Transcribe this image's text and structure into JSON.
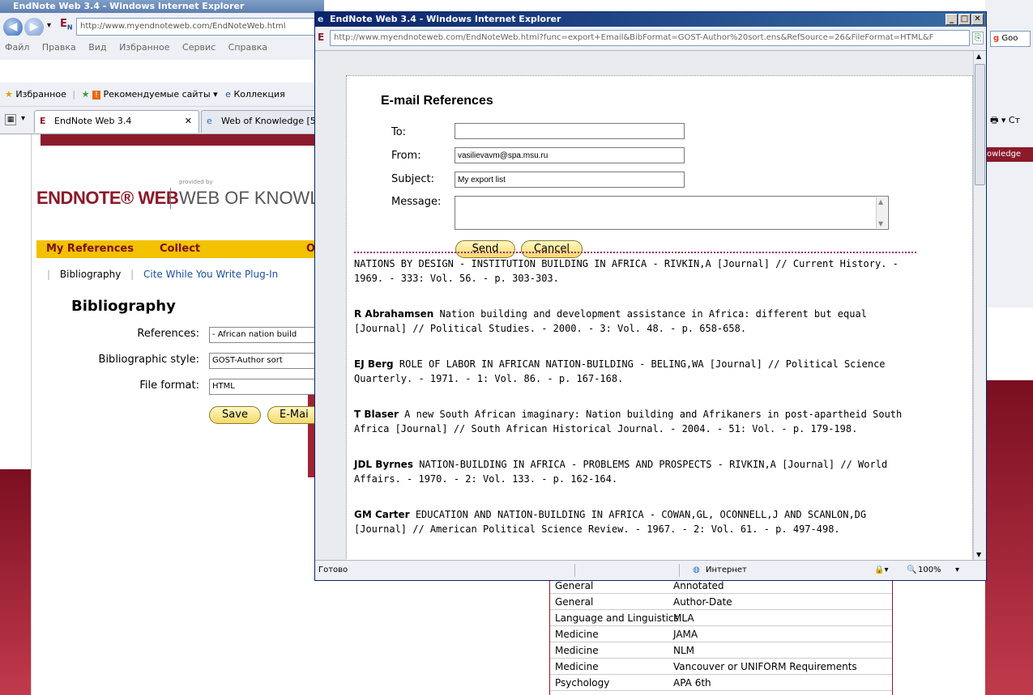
{
  "bg_window": {
    "title": "EndNote Web 3.4 - Windows Internet Explorer",
    "url": "http://www.myendnoteweb.com/EndNoteWeb.html",
    "menu": [
      "Файл",
      "Правка",
      "Вид",
      "Избранное",
      "Сервис",
      "Справка"
    ],
    "favorites_label": "Избранное",
    "fav_links": [
      "Рекомендуемые сайты ▾",
      "Коллекция"
    ],
    "tabs": [
      "EndNote Web 3.4",
      "Web of Knowledge [5"
    ],
    "right_band_text": "owledge",
    "right_addr_text": "Goo",
    "right_toolbar_text": "Ст"
  },
  "endnote": {
    "logo": "ENDNOTE® WEB",
    "provided_by": "provided by",
    "wok": "WEB OF KNOWLEDG",
    "tabs": [
      "My References",
      "Collect",
      "Or"
    ],
    "subnav": [
      "Bibliography",
      "Cite While You Write Plug-In"
    ],
    "page_title": "Bibliography",
    "fields": [
      {
        "label": "References:",
        "value": "- African nation build"
      },
      {
        "label": "Bibliographic style:",
        "value": "GOST-Author sort"
      },
      {
        "label": "File format:",
        "value": "HTML"
      }
    ],
    "save_label": "Save",
    "email_label": "E-Mai"
  },
  "popup": {
    "title": "EndNote Web 3.4 - Windows Internet Explorer",
    "url": "http://www.myendnoteweb.com/EndNoteWeb.html?func=export+Email&BibFormat=GOST-Author%20sort.ens&RefSource=26&FileFormat=HTML&F",
    "status_ready": "Готово",
    "status_zone": "Интернет",
    "zoom": "100%",
    "email": {
      "heading": "E-mail References",
      "to_label": "To:",
      "to_value": "",
      "from_label": "From:",
      "from_value": "vasilievavm@spa.msu.ru",
      "subject_label": "Subject:",
      "subject_value": "My export list",
      "message_label": "Message:",
      "send": "Send",
      "cancel": "Cancel"
    },
    "references": [
      {
        "author": "",
        "text": "NATIONS BY DESIGN - INSTITUTION BUILDING IN AFRICA - RIVKIN,A [Journal] // Current History. - 1969. - 333: Vol. 56. - p. 303-303."
      },
      {
        "author": "R Abrahamsen",
        "text": "Nation building and development assistance in Africa: different but equal [Journal] // Political Studies. - 2000. - 3: Vol. 48. - p. 658-658."
      },
      {
        "author": "EJ Berg",
        "text": "ROLE OF LABOR IN AFRICAN NATION-BUILDING - BELING,WA [Journal] // Political Science Quarterly. - 1971. - 1: Vol. 86. - p. 167-168."
      },
      {
        "author": "T Blaser",
        "text": "A new South African imaginary: Nation building and Afrikaners in post-apartheid South Africa [Journal] // South African Historical Journal. - 2004. - 51: Vol. - p. 179-198."
      },
      {
        "author": "JDL Byrnes",
        "text": "NATION-BUILDING IN AFRICA - PROBLEMS AND PROSPECTS - RIVKIN,A [Journal] // World Affairs. - 1970. - 2: Vol. 133. - p. 162-164."
      },
      {
        "author": "GM Carter",
        "text": "EDUCATION AND NATION-BUILDING IN AFRICA - COWAN,GL, OCONNELL,J AND SCANLON,DG [Journal] // American Political Science Review. - 1967. - 2: Vol. 61. - p. 497-498."
      }
    ]
  },
  "styles_table": [
    {
      "category": "General",
      "style": "Annotated"
    },
    {
      "category": "General",
      "style": "Author-Date"
    },
    {
      "category": "Language and Linguistics",
      "style": "MLA"
    },
    {
      "category": "Medicine",
      "style": "JAMA"
    },
    {
      "category": "Medicine",
      "style": "NLM"
    },
    {
      "category": "Medicine",
      "style": "Vancouver or UNIFORM Requirements"
    },
    {
      "category": "Psychology",
      "style": "APA 6th"
    }
  ],
  "colors": {
    "brand_red": "#8b1a2b",
    "tab_yellow": "#f2c100",
    "link_blue": "#1a4f9c",
    "divider_magenta": "#a0106a"
  }
}
